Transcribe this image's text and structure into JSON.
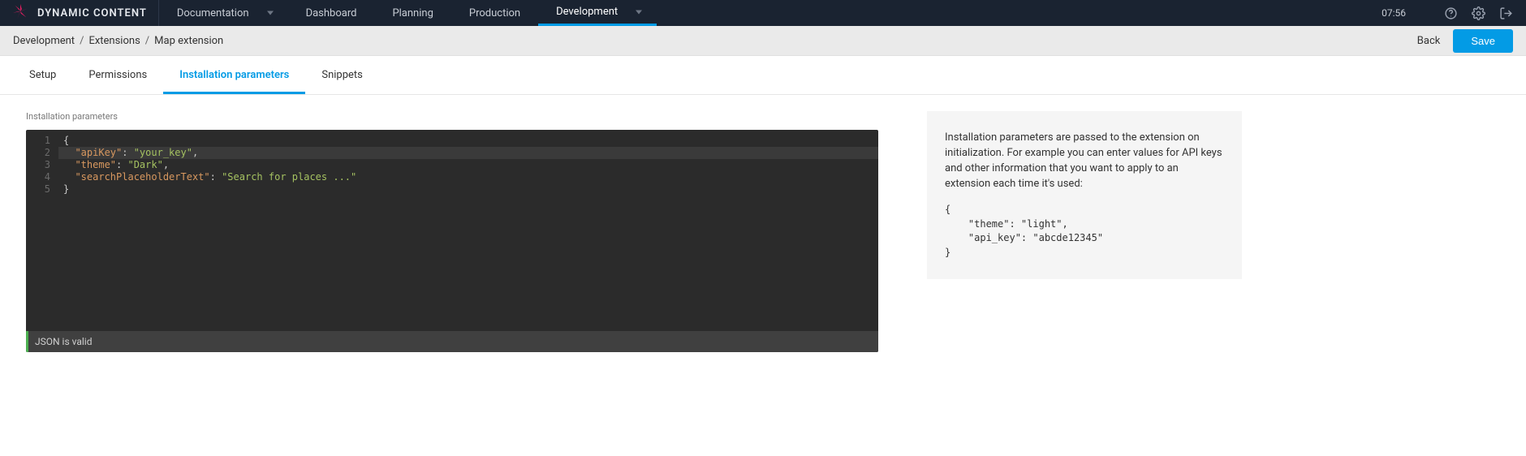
{
  "brand": "DYNAMIC CONTENT",
  "topnav": {
    "documentation": "Documentation",
    "dashboard": "Dashboard",
    "planning": "Planning",
    "production": "Production",
    "development": "Development"
  },
  "time": "07:56",
  "breadcrumb": {
    "a": "Development",
    "b": "Extensions",
    "c": "Map extension"
  },
  "actions": {
    "back": "Back",
    "save": "Save"
  },
  "tabs": {
    "setup": "Setup",
    "permissions": "Permissions",
    "install": "Installation parameters",
    "snippets": "Snippets"
  },
  "section_label": "Installation parameters",
  "code": {
    "l1": "{",
    "l2_key": "\"apiKey\"",
    "l2_val": "\"your_key\"",
    "l3_key": "\"theme\"",
    "l3_val": "\"Dark\"",
    "l4_key": "\"searchPlaceholderText\"",
    "l4_val": "\"Search for places ...\"",
    "l5": "}"
  },
  "line_numbers": {
    "n1": "1",
    "n2": "2",
    "n3": "3",
    "n4": "4",
    "n5": "5"
  },
  "status": "JSON is valid",
  "help": {
    "text": "Installation parameters are passed to the extension on initialization. For example you can enter values for API keys and other information that you want to apply to an extension each time it's used:",
    "example": "{\n    \"theme\": \"light\",\n    \"api_key\": \"abcde12345\"\n}"
  }
}
